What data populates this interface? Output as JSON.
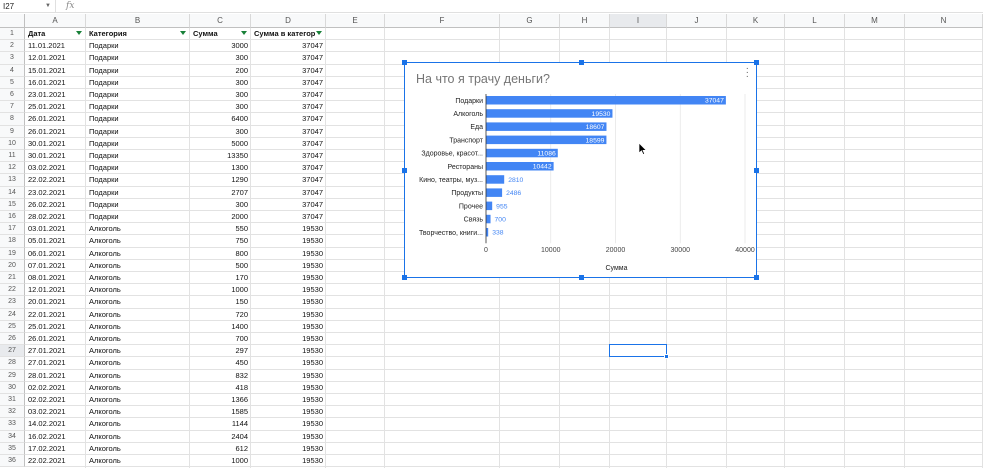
{
  "namebox": {
    "value": "I27"
  },
  "formula": {
    "fx": "fx"
  },
  "columns": [
    {
      "label": "",
      "w": 0
    },
    {
      "label": "A"
    },
    {
      "label": "B"
    },
    {
      "label": "C"
    },
    {
      "label": "D"
    },
    {
      "label": "E"
    },
    {
      "label": "F"
    },
    {
      "label": "G"
    },
    {
      "label": "H"
    },
    {
      "label": "I"
    },
    {
      "label": "J"
    },
    {
      "label": "K"
    },
    {
      "label": "L"
    },
    {
      "label": "M"
    },
    {
      "label": "N"
    }
  ],
  "headers": [
    "Дата",
    "Категория",
    "Сумма",
    "Сумма в категор"
  ],
  "rows": [
    [
      "11.01.2021",
      "Подарки",
      "3000",
      "37047"
    ],
    [
      "12.01.2021",
      "Подарки",
      "300",
      "37047"
    ],
    [
      "15.01.2021",
      "Подарки",
      "200",
      "37047"
    ],
    [
      "16.01.2021",
      "Подарки",
      "300",
      "37047"
    ],
    [
      "23.01.2021",
      "Подарки",
      "300",
      "37047"
    ],
    [
      "25.01.2021",
      "Подарки",
      "300",
      "37047"
    ],
    [
      "26.01.2021",
      "Подарки",
      "6400",
      "37047"
    ],
    [
      "26.01.2021",
      "Подарки",
      "300",
      "37047"
    ],
    [
      "30.01.2021",
      "Подарки",
      "5000",
      "37047"
    ],
    [
      "30.01.2021",
      "Подарки",
      "13350",
      "37047"
    ],
    [
      "03.02.2021",
      "Подарки",
      "1300",
      "37047"
    ],
    [
      "22.02.2021",
      "Подарки",
      "1290",
      "37047"
    ],
    [
      "23.02.2021",
      "Подарки",
      "2707",
      "37047"
    ],
    [
      "26.02.2021",
      "Подарки",
      "300",
      "37047"
    ],
    [
      "28.02.2021",
      "Подарки",
      "2000",
      "37047"
    ],
    [
      "03.01.2021",
      "Алкоголь",
      "550",
      "19530"
    ],
    [
      "05.01.2021",
      "Алкоголь",
      "750",
      "19530"
    ],
    [
      "06.01.2021",
      "Алкоголь",
      "800",
      "19530"
    ],
    [
      "07.01.2021",
      "Алкоголь",
      "500",
      "19530"
    ],
    [
      "08.01.2021",
      "Алкоголь",
      "170",
      "19530"
    ],
    [
      "12.01.2021",
      "Алкоголь",
      "1000",
      "19530"
    ],
    [
      "20.01.2021",
      "Алкоголь",
      "150",
      "19530"
    ],
    [
      "22.01.2021",
      "Алкоголь",
      "720",
      "19530"
    ],
    [
      "25.01.2021",
      "Алкоголь",
      "1400",
      "19530"
    ],
    [
      "26.01.2021",
      "Алкоголь",
      "700",
      "19530"
    ],
    [
      "27.01.2021",
      "Алкоголь",
      "297",
      "19530"
    ],
    [
      "27.01.2021",
      "Алкоголь",
      "450",
      "19530"
    ],
    [
      "28.01.2021",
      "Алкоголь",
      "832",
      "19530"
    ],
    [
      "02.02.2021",
      "Алкоголь",
      "418",
      "19530"
    ],
    [
      "02.02.2021",
      "Алкоголь",
      "1366",
      "19530"
    ],
    [
      "03.02.2021",
      "Алкоголь",
      "1585",
      "19530"
    ],
    [
      "14.02.2021",
      "Алкоголь",
      "1144",
      "19530"
    ],
    [
      "16.02.2021",
      "Алкоголь",
      "2404",
      "19530"
    ],
    [
      "17.02.2021",
      "Алкоголь",
      "612",
      "19530"
    ],
    [
      "22.02.2021",
      "Алкоголь",
      "1000",
      "19530"
    ]
  ],
  "colors": {
    "accent": "#1a73e8",
    "bar": "#4285f4",
    "filter": "#188038"
  },
  "chart_data": {
    "type": "bar",
    "orientation": "horizontal",
    "title": "На что я трачу деньги?",
    "xlabel": "Сумма",
    "ylabel": "",
    "categories": [
      "Подарки",
      "Алкоголь",
      "Еда",
      "Транспорт",
      "Здоровье, красот...",
      "Рестораны",
      "Кино, театры, муз...",
      "Продукты",
      "Прочее",
      "Связь",
      "Творчество, книги..."
    ],
    "values": [
      37047,
      19530,
      18607,
      18599,
      11086,
      10442,
      2810,
      2486,
      955,
      700,
      338
    ],
    "xlim": [
      0,
      40000
    ],
    "xticks": [
      "0",
      "10000",
      "20000",
      "30000",
      "40000"
    ],
    "grid": true,
    "legend": "none"
  }
}
